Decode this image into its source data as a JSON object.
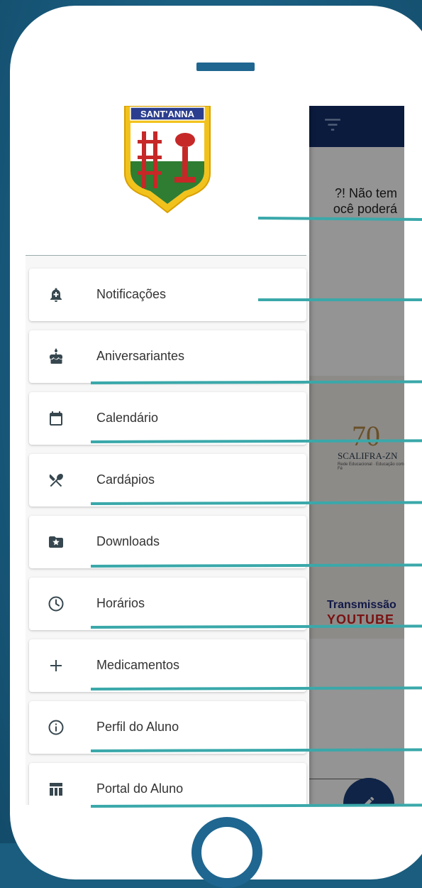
{
  "colors": {
    "background": "#1a5d7e",
    "phone_accent": "#1f6690",
    "app_bar": "#13306b",
    "callout": "#3aa8aa",
    "fab": "#1b3f7a"
  },
  "logo": {
    "banner_text": "SANT'ANNA"
  },
  "background_app": {
    "intro_line_1": "?! Não tem",
    "intro_line_2": "ocê poderá",
    "banner_anniversary": "70",
    "banner_brand": "SCALIFRA-ZN",
    "banner_subtitle": "Rede Educacional · Educação com Fé",
    "stream_label": "Transmissão",
    "stream_platform": "YOUTUBE"
  },
  "menu": {
    "items": [
      {
        "label": "Notificações",
        "icon": "notification-bell-icon"
      },
      {
        "label": "Aniversariantes",
        "icon": "birthday-cake-icon"
      },
      {
        "label": "Calendário",
        "icon": "calendar-icon"
      },
      {
        "label": "Cardápios",
        "icon": "cutlery-icon"
      },
      {
        "label": "Downloads",
        "icon": "starred-folder-icon"
      },
      {
        "label": "Horários",
        "icon": "clock-icon"
      },
      {
        "label": "Medicamentos",
        "icon": "plus-icon"
      },
      {
        "label": "Perfil do Aluno",
        "icon": "info-icon"
      },
      {
        "label": "Portal do Aluno",
        "icon": "table-icon"
      }
    ]
  }
}
